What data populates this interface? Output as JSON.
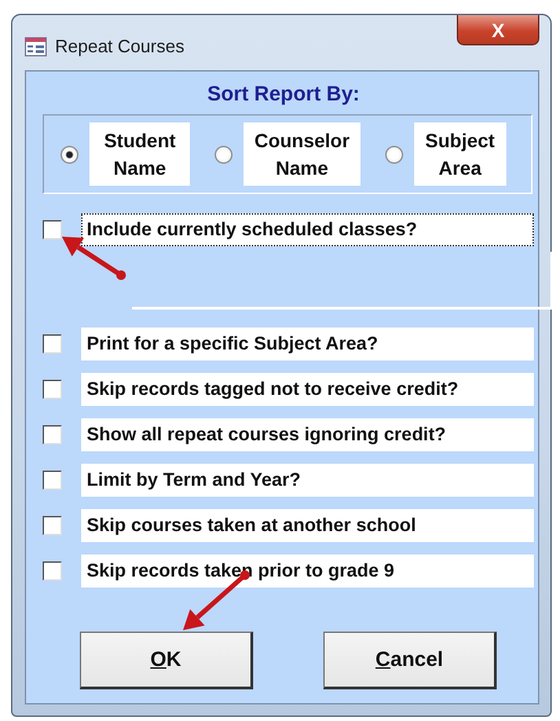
{
  "window": {
    "title": "Repeat Courses",
    "close_label": "X"
  },
  "sort": {
    "title": "Sort Report By:",
    "options": [
      {
        "label": "Student Name",
        "selected": true
      },
      {
        "label": "Counselor Name",
        "selected": false
      },
      {
        "label": "Subject Area",
        "selected": false
      }
    ]
  },
  "options": [
    {
      "label": "Include currently scheduled classes?",
      "checked": false,
      "focused": true
    },
    {
      "label": "Print for a specific Subject Area?",
      "checked": false,
      "focused": false
    },
    {
      "label": "Skip records tagged not to receive credit?",
      "checked": false,
      "focused": false
    },
    {
      "label": "Show all repeat courses ignoring credit?",
      "checked": false,
      "focused": false
    },
    {
      "label": "Limit by Term and Year?",
      "checked": false,
      "focused": false
    },
    {
      "label": "Skip courses taken at another school",
      "checked": false,
      "focused": false
    },
    {
      "label": "Skip records taken prior to grade 9",
      "checked": false,
      "focused": false
    }
  ],
  "buttons": [
    {
      "access_key": "O",
      "rest": "K"
    },
    {
      "access_key": "C",
      "rest": "ancel"
    }
  ]
}
